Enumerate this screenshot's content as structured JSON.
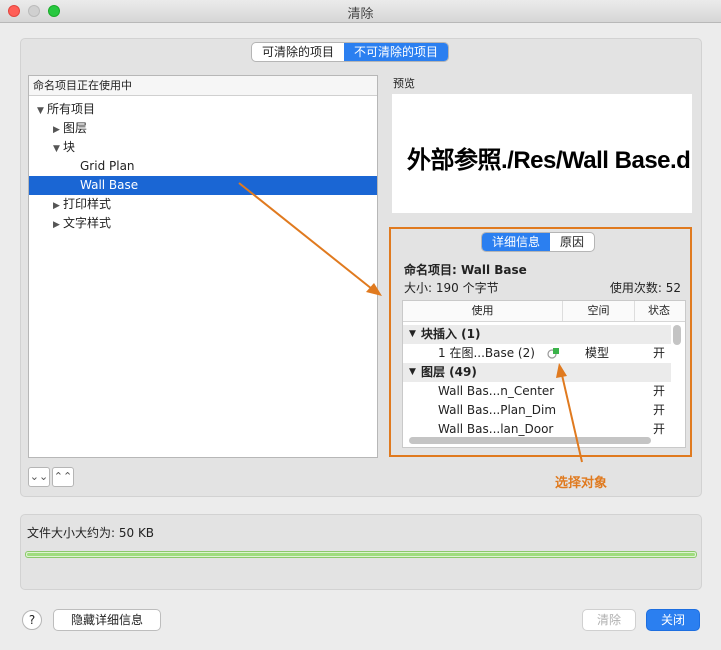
{
  "window": {
    "title": "清除"
  },
  "tabs": [
    {
      "label": "可清除的项目"
    },
    {
      "label": "不可清除的项目"
    }
  ],
  "tree": {
    "header": "命名项目正在使用中",
    "items": [
      {
        "label": "所有项目",
        "expander": "▼"
      },
      {
        "label": "图层",
        "expander": "▶"
      },
      {
        "label": "块",
        "expander": "▼"
      },
      {
        "label": "Grid Plan"
      },
      {
        "label": "Wall Base"
      },
      {
        "label": "打印样式",
        "expander": "▶"
      },
      {
        "label": "文字样式",
        "expander": "▶"
      }
    ]
  },
  "expand_buttons": {
    "collapse_all": "⌄⌄",
    "expand_all": "⌃⌃"
  },
  "preview": {
    "label": "预览",
    "text": "外部参照./Res/Wall Base.d"
  },
  "details": {
    "tabs": [
      {
        "label": "详细信息"
      },
      {
        "label": "原因"
      }
    ],
    "named_item": "命名项目: Wall Base",
    "size": "大小: 190 个字节",
    "usage_count": "使用次数: 52",
    "columns": [
      "使用",
      "空间",
      "状态"
    ],
    "groups": [
      {
        "label": "块插入 (1)",
        "expander": "▼",
        "rows": [
          {
            "use": "1 在图...Base (2)",
            "space": "模型",
            "state": "开"
          }
        ]
      },
      {
        "label": "图层 (49)",
        "expander": "▼",
        "rows": [
          {
            "use": "Wall Bas...n_Center",
            "space": "",
            "state": "开"
          },
          {
            "use": "Wall Bas...Plan_Dim",
            "space": "",
            "state": "开"
          },
          {
            "use": "Wall Bas...lan_Door",
            "space": "",
            "state": "开"
          }
        ]
      }
    ]
  },
  "annotation": {
    "label": "选择对象",
    "color": "#e07a1f"
  },
  "status": {
    "file_size": "文件大小大约为: 50 KB"
  },
  "footer": {
    "help": "?",
    "hide_details": "隐藏详细信息",
    "purge": "清除",
    "close": "关闭"
  },
  "colors": {
    "accent": "#2b7ff0",
    "selection": "#1a66d4",
    "progress": "#7fd35a"
  }
}
